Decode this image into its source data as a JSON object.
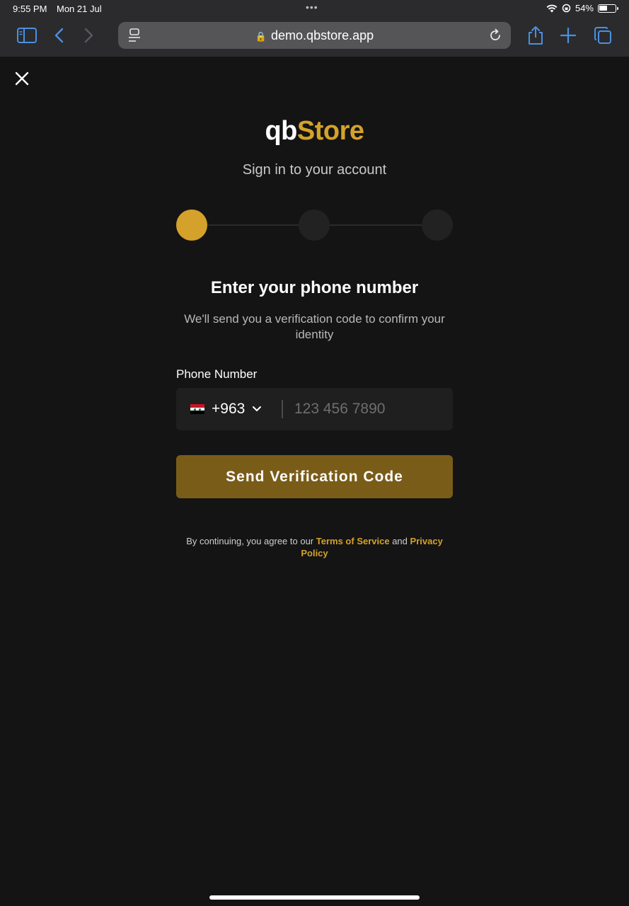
{
  "status_bar": {
    "time": "9:55 PM",
    "date": "Mon 21 Jul",
    "battery": "54%",
    "battery_level": 0.54
  },
  "browser": {
    "url": "demo.qbstore.app"
  },
  "page": {
    "logo_part1": "qb",
    "logo_part2": "Store",
    "subtitle": "Sign in to your account",
    "steps": {
      "total": 3,
      "current": 1
    },
    "heading": "Enter your phone number",
    "description": "We'll send you a verification code to confirm your identity",
    "phone_label": "Phone Number",
    "country_code": "+963",
    "phone_placeholder": "123 456 7890",
    "phone_value": "",
    "submit_label": "Send Verification Code",
    "terms_prefix": "By continuing, you agree to our",
    "terms_link": "Terms of Service",
    "terms_and": "and",
    "privacy_link": "Privacy Policy"
  },
  "colors": {
    "accent": "#d4a22a",
    "button": "#7a5c19",
    "background": "#141414",
    "field": "#1f1f1f",
    "browser_accent": "#4a90e2"
  }
}
